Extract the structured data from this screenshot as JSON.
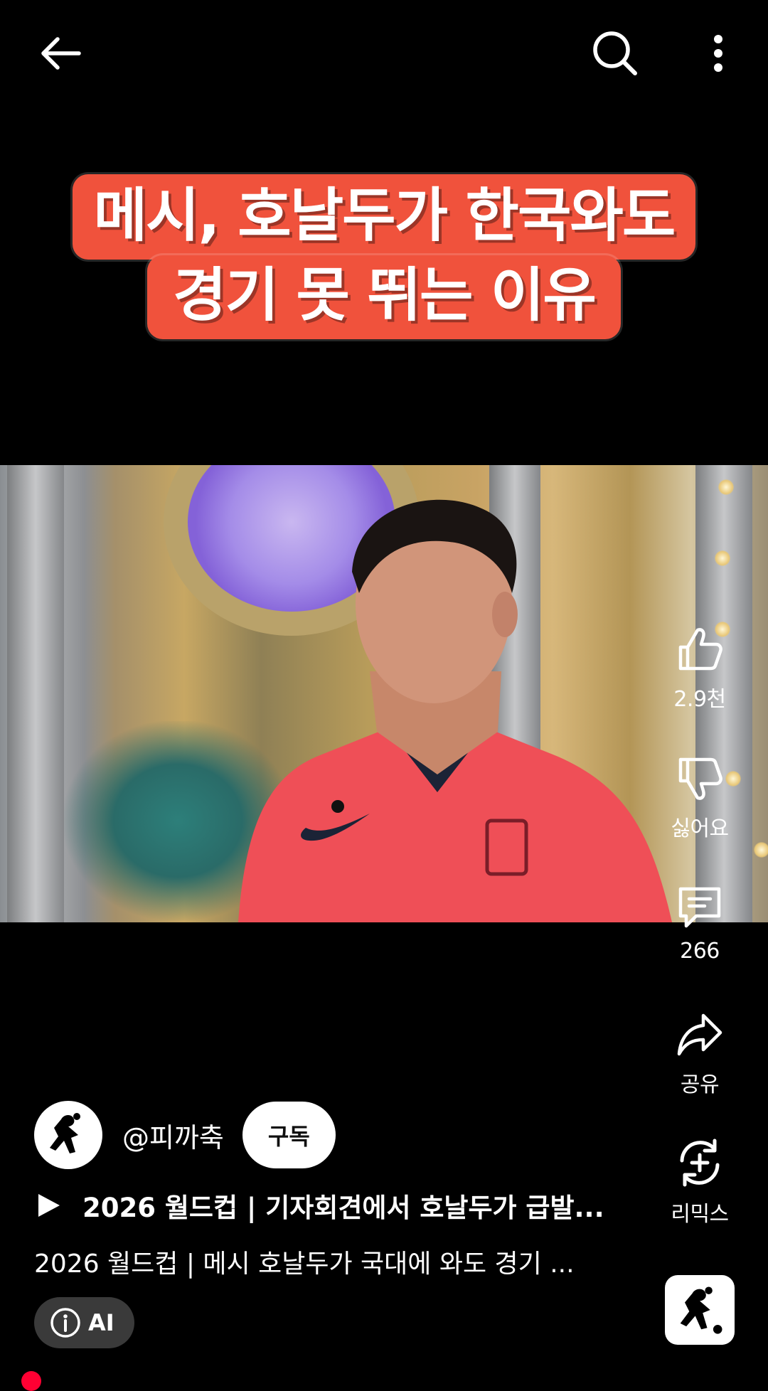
{
  "topbar": {
    "back_icon": "arrow-left-icon",
    "search_icon": "search-icon",
    "more_icon": "more-vertical-icon"
  },
  "video": {
    "title_line1": "메시, 호날두가 한국와도",
    "title_line2": "경기 못 뛰는 이유",
    "title_bg_color": "#f0523c"
  },
  "actions": {
    "like_count": "2.9천",
    "dislike_label": "싫어요",
    "comment_count": "266",
    "share_label": "공유",
    "remix_label": "리믹스"
  },
  "channel": {
    "handle": "@피까축",
    "subscribe_label": "구독"
  },
  "playlist": {
    "title": "2026 월드컵 | 기자회견에서 호날두가 급발..."
  },
  "description": "2026 월드컵 | 메시 호날두가 국대에 와도 경기  ...",
  "ai_chip": {
    "label": "AI"
  },
  "colors": {
    "background": "#000000",
    "subscribe_bg": "#ffffff",
    "chip_bg": "#3a3a3a",
    "notification_dot": "#ff0033"
  }
}
